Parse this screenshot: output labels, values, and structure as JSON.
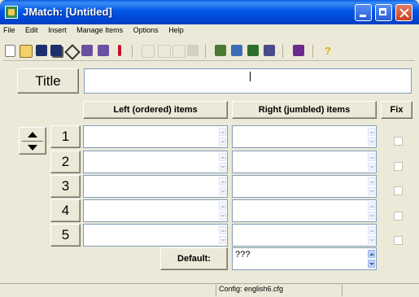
{
  "window": {
    "title": "JMatch: [Untitled]"
  },
  "menu": [
    "File",
    "Edit",
    "Insert",
    "Manage Items",
    "Options",
    "Help"
  ],
  "toolbar": [
    "new-file-icon",
    "open-folder-icon",
    "save-icon",
    "save-as-icon",
    "diamond-icon",
    "web-export-icon",
    "web-export-alt-icon",
    "red-down-arrow-icon",
    "undo-icon",
    "cut-icon",
    "copy-icon",
    "paste-icon",
    "add-item-icon",
    "edit-item-icon",
    "translate-icon",
    "shuffle-icon",
    "palette-icon",
    "help-icon"
  ],
  "title_label": "Title",
  "title_value": "",
  "headers": {
    "left": "Left (ordered) items",
    "right": "Right (jumbled) items",
    "fix": "Fix"
  },
  "rows": [
    {
      "number": "1",
      "left": "",
      "right": "",
      "fix": false
    },
    {
      "number": "2",
      "left": "",
      "right": "",
      "fix": false
    },
    {
      "number": "3",
      "left": "",
      "right": "",
      "fix": false
    },
    {
      "number": "4",
      "left": "",
      "right": "",
      "fix": false
    },
    {
      "number": "5",
      "left": "",
      "right": "",
      "fix": false
    }
  ],
  "default_label": "Default:",
  "default_value": "???",
  "status": {
    "config": "Config: english6.cfg"
  }
}
